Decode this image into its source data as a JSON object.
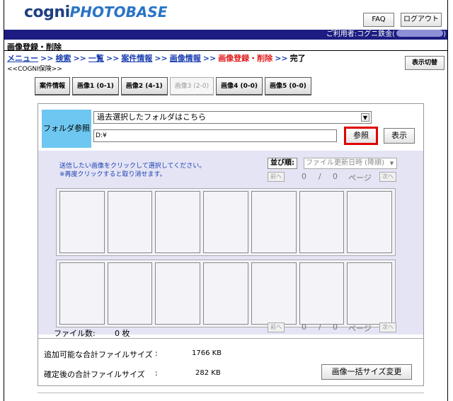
{
  "header": {
    "logo_part1": "cogni",
    "logo_part2": "PHOTOBASE",
    "faq_label": "FAQ",
    "logout_label": "ログアウト",
    "user_prefix": "ご利用者:コグニ鉄金(",
    "user_suffix": ")"
  },
  "page": {
    "section_title": "画像登録・削除",
    "back_link": "<<COGNI保険>>",
    "view_toggle_label": "表示切替"
  },
  "breadcrumb": {
    "items": [
      "メニュー",
      "検索",
      "一覧",
      "案件情報",
      "画像情報",
      "画像登録・削除",
      "完了"
    ],
    "separator": ">>"
  },
  "tabs": [
    {
      "label": "案件情報",
      "disabled": false
    },
    {
      "label": "画像1 (0-1)",
      "disabled": false
    },
    {
      "label": "画像2 (4-1)",
      "disabled": false
    },
    {
      "label": "画像3 (2-0)",
      "disabled": true
    },
    {
      "label": "画像4 (0-0)",
      "disabled": false
    },
    {
      "label": "画像5 (0-0)",
      "disabled": false
    }
  ],
  "folder": {
    "label": "フォルダ参照",
    "select_value": "過去選択したフォルダはこちら",
    "path_value": "D:¥",
    "browse_label": "参照",
    "show_label": "表示"
  },
  "grid": {
    "instruction_line1": "送信したい画像をクリックして選択してください。",
    "instruction_line2": "※再度クリックすると取り消せます。",
    "sort_label": "並び順:",
    "sort_value": "ファイル更新日時 (降順)",
    "prev_label": "前へ",
    "next_label": "次へ",
    "page_current": "0",
    "page_sep": "/",
    "page_total": "0",
    "page_unit": "ページ",
    "thumbs_per_row": 7,
    "rows": 2,
    "filecount_label": "ファイル数:",
    "filecount_value": "0 枚"
  },
  "summary": {
    "addable_label": "追加可能な合計ファイルサイズ",
    "addable_colon": ":",
    "addable_value": "1766 KB",
    "confirmed_label": "確定後の合計ファイルサイズ",
    "confirmed_colon": ":",
    "confirmed_value": "282 KB",
    "resize_button_label": "画像一括サイズ変更"
  }
}
